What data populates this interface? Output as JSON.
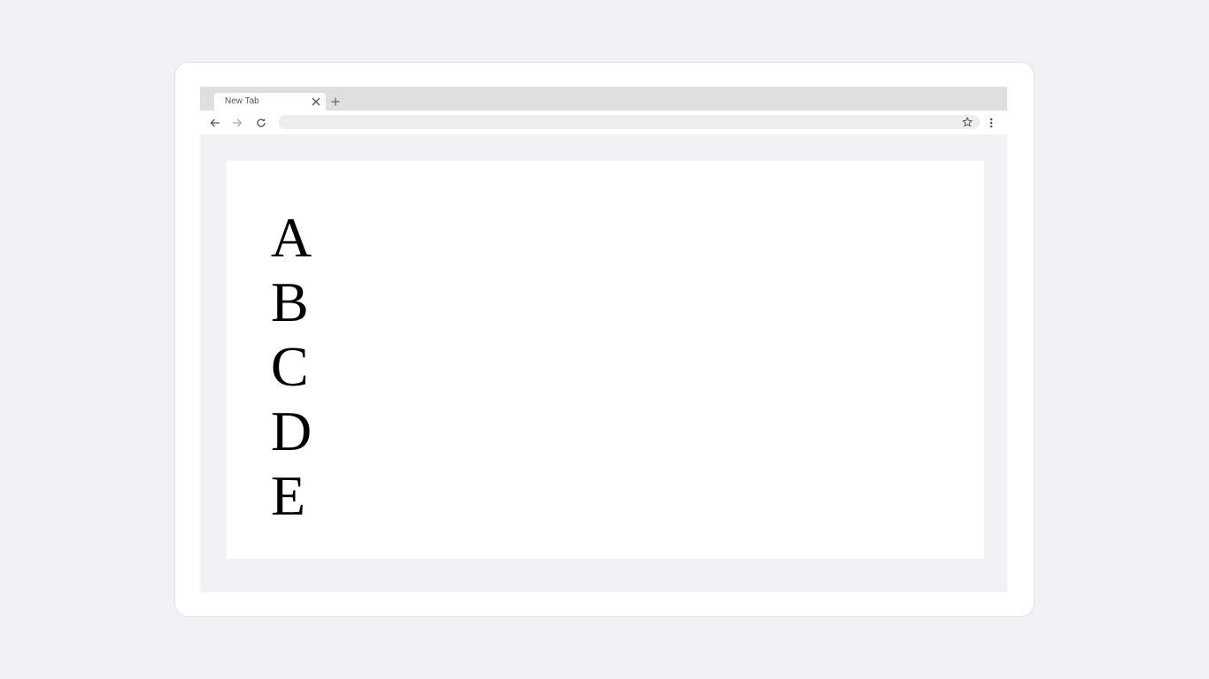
{
  "browser": {
    "tab": {
      "title": "New Tab",
      "close_icon": "close-icon"
    },
    "new_tab_icon": "plus-icon",
    "toolbar": {
      "back_icon": "arrow-left-icon",
      "forward_icon": "arrow-right-icon",
      "reload_icon": "reload-icon",
      "address_value": "",
      "bookmark_icon": "star-icon",
      "menu_icon": "kebab-menu-icon"
    }
  },
  "page": {
    "letters": [
      "A",
      "B",
      "C",
      "D",
      "E"
    ]
  },
  "colors": {
    "background": "#f0f2f5",
    "tabstrip": "#dfdfdf",
    "omnibox": "#ededed",
    "text": "#000000"
  }
}
